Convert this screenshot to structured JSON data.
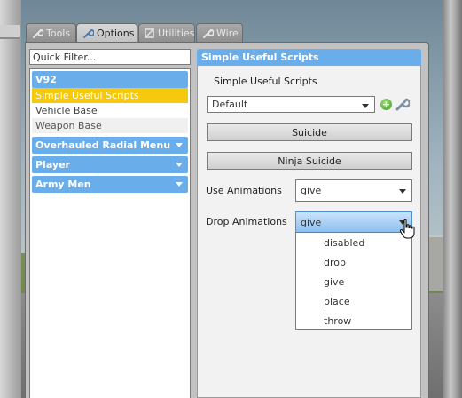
{
  "tabs": [
    {
      "label": "Tools",
      "icon": "wrench-icon",
      "active": false
    },
    {
      "label": "Options",
      "icon": "wrench-icon",
      "active": true
    },
    {
      "label": "Utilities",
      "icon": "utilities-icon",
      "active": false
    },
    {
      "label": "Wire",
      "icon": "wrench-icon",
      "active": false
    }
  ],
  "filter": {
    "placeholder": "Quick Filter...",
    "value": ""
  },
  "categories": [
    {
      "title": "V92",
      "expanded": true,
      "items": [
        "Simple Useful Scripts",
        "Vehicle Base",
        "Weapon Base"
      ],
      "selected": "Simple Useful Scripts"
    },
    {
      "title": "Overhauled Radial Menu",
      "expanded": false
    },
    {
      "title": "Player",
      "expanded": false
    },
    {
      "title": "Army Men",
      "expanded": false
    }
  ],
  "panel": {
    "header": "Simple Useful Scripts",
    "subtitle": "Simple Useful Scripts",
    "preset": {
      "value": "Default"
    },
    "buttons": {
      "suicide": "Suicide",
      "ninja_suicide": "Ninja Suicide"
    },
    "use_animations": {
      "label": "Use Animations",
      "value": "give"
    },
    "drop_animations": {
      "label": "Drop Animations",
      "value": "give",
      "open": true,
      "options": [
        "disabled",
        "drop",
        "give",
        "place",
        "throw"
      ]
    }
  },
  "colors": {
    "accent": "#6aadeb",
    "selected_item": "#f6c90d",
    "panel_bg": "#c2c2c2"
  }
}
